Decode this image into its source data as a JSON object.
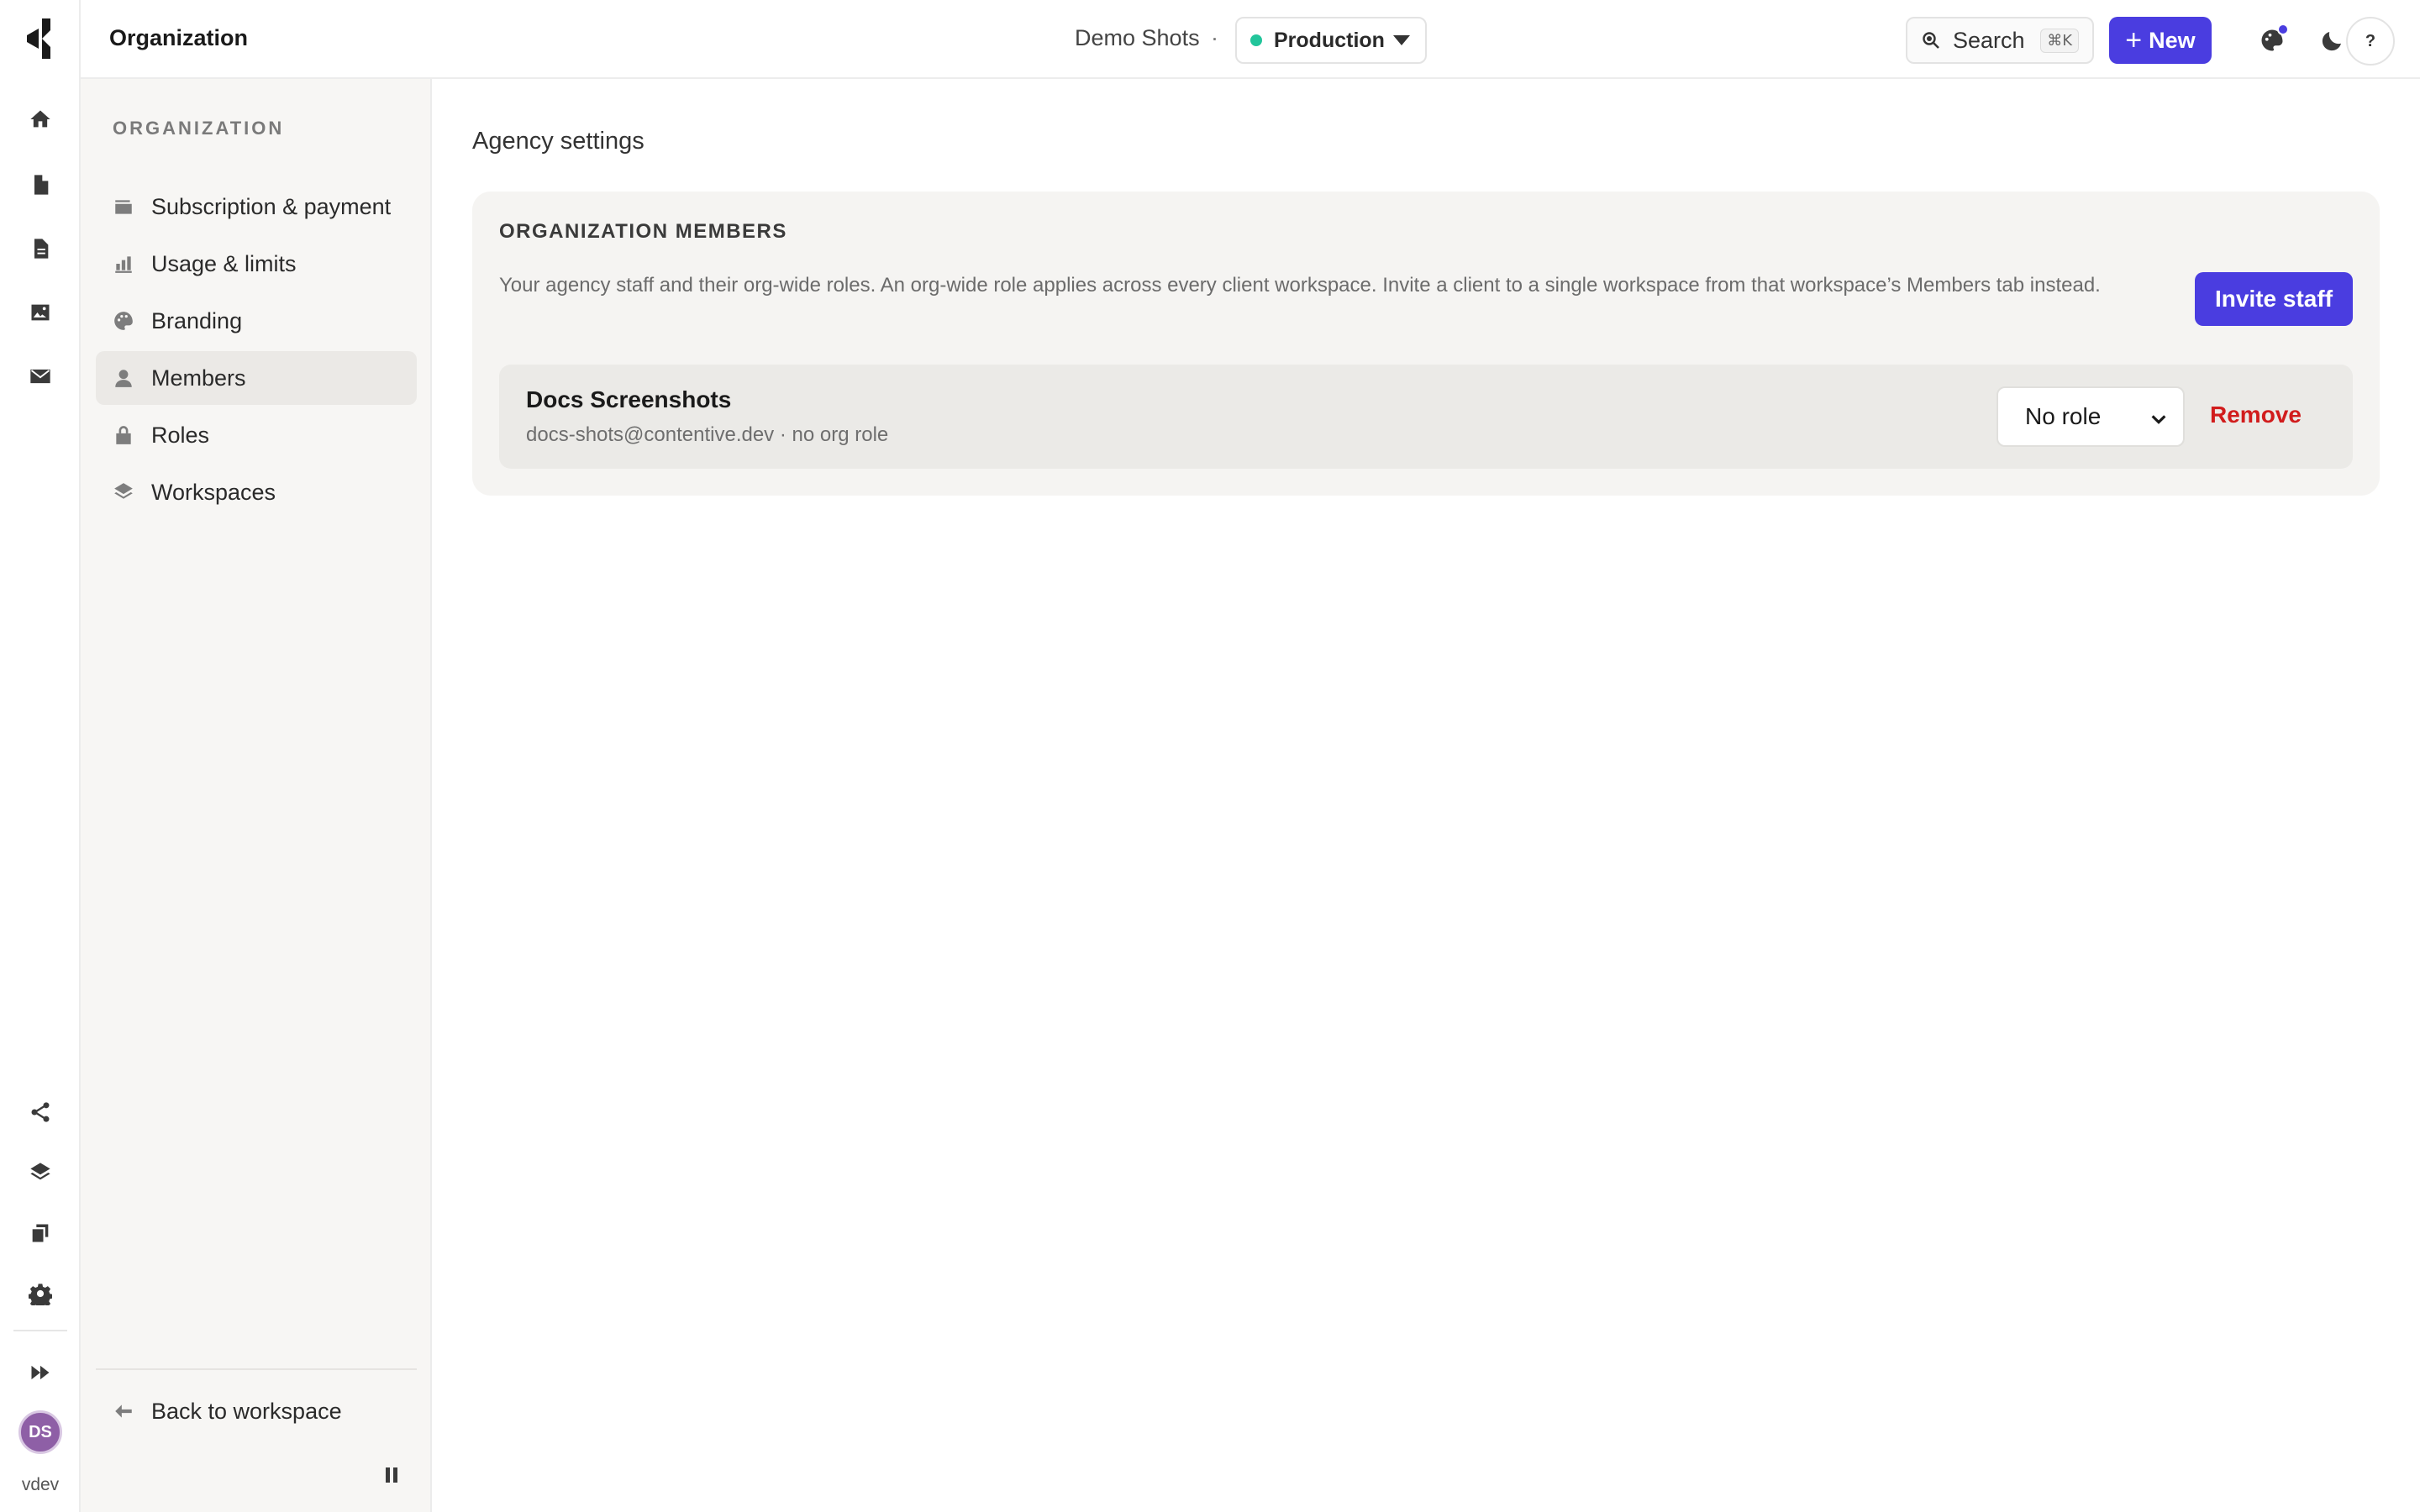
{
  "topbar": {
    "title": "Organization",
    "project": "Demo Shots",
    "separator": "·",
    "environment": "Production",
    "search_label": "Search",
    "search_shortcut": "⌘K",
    "new_label": "New",
    "help_label": "?"
  },
  "rail": {
    "items": [
      "home-icon",
      "page-icon",
      "document-icon",
      "image-icon",
      "mail-icon"
    ],
    "bottom_items": [
      "share-icon",
      "layers-icon",
      "copy-icon",
      "gear-icon",
      "fast-forward-icon"
    ],
    "avatar_initials": "DS",
    "user_label": "vdev",
    "avatar_color": "#8e5fa6"
  },
  "sidebar": {
    "heading": "ORGANIZATION",
    "items": [
      {
        "label": "Subscription & payment",
        "icon": "card-icon"
      },
      {
        "label": "Usage & limits",
        "icon": "bar-chart-icon"
      },
      {
        "label": "Branding",
        "icon": "palette-icon"
      },
      {
        "label": "Members",
        "icon": "person-icon",
        "active": true
      },
      {
        "label": "Roles",
        "icon": "lock-icon"
      },
      {
        "label": "Workspaces",
        "icon": "layers-icon"
      }
    ],
    "back_label": "Back to workspace"
  },
  "main": {
    "title": "Agency settings",
    "card": {
      "heading": "ORGANIZATION MEMBERS",
      "description": "Your agency staff and their org-wide roles. An org-wide role applies across every client workspace. Invite a client to a single workspace from that workspace’s Members tab instead.",
      "invite_label": "Invite staff",
      "members": [
        {
          "name": "Docs Screenshots",
          "detail": "docs-shots@contentive.dev · no org role",
          "role": "No role",
          "remove_label": "Remove"
        }
      ]
    }
  },
  "colors": {
    "accent": "#4a3de0",
    "danger": "#d11c1c",
    "env_status": "#22c59b"
  }
}
